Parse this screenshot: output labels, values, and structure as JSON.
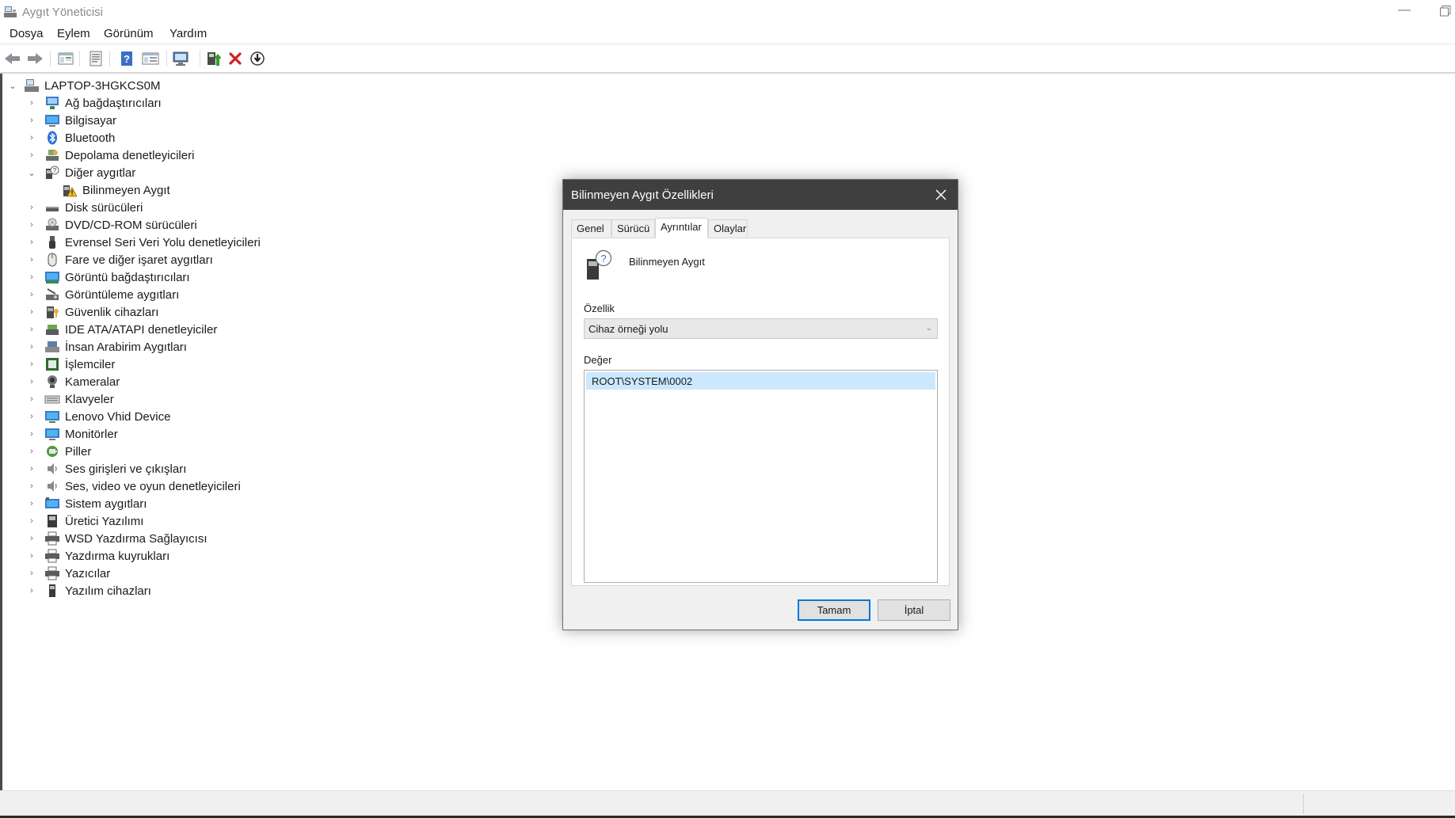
{
  "window": {
    "title": "Aygıt Yöneticisi"
  },
  "menu": [
    "Dosya",
    "Eylem",
    "Görünüm",
    "Yardım"
  ],
  "toolbar": [
    "back-icon",
    "forward-icon",
    "show-hide-tree-icon",
    "properties-icon",
    "help-icon",
    "view-resources-icon",
    "scan-hardware-icon",
    "update-driver-icon",
    "uninstall-icon",
    "disable-icon"
  ],
  "tree": {
    "root": "LAPTOP-3HGKCS0M",
    "items": [
      {
        "label": "Ağ bağdaştırıcıları",
        "icon": "network-adapter-icon",
        "expanded": false
      },
      {
        "label": "Bilgisayar",
        "icon": "computer-icon",
        "expanded": false
      },
      {
        "label": "Bluetooth",
        "icon": "bluetooth-icon",
        "expanded": false
      },
      {
        "label": "Depolama denetleyicileri",
        "icon": "storage-controller-icon",
        "expanded": false
      },
      {
        "label": "Diğer aygıtlar",
        "icon": "other-devices-icon",
        "expanded": true
      },
      {
        "label": "Bilinmeyen Aygıt",
        "icon": "unknown-device-warning-icon",
        "child": true
      },
      {
        "label": "Disk sürücüleri",
        "icon": "disk-drive-icon",
        "expanded": false
      },
      {
        "label": "DVD/CD-ROM sürücüleri",
        "icon": "dvd-drive-icon",
        "expanded": false
      },
      {
        "label": "Evrensel Seri Veri Yolu denetleyicileri",
        "icon": "usb-icon",
        "expanded": false
      },
      {
        "label": "Fare ve diğer işaret aygıtları",
        "icon": "mouse-icon",
        "expanded": false
      },
      {
        "label": "Görüntü bağdaştırıcıları",
        "icon": "display-adapter-icon",
        "expanded": false
      },
      {
        "label": "Görüntüleme aygıtları",
        "icon": "imaging-device-icon",
        "expanded": false
      },
      {
        "label": "Güvenlik cihazları",
        "icon": "security-device-icon",
        "expanded": false
      },
      {
        "label": "IDE ATA/ATAPI denetleyiciler",
        "icon": "ide-controller-icon",
        "expanded": false
      },
      {
        "label": "İnsan Arabirim Aygıtları",
        "icon": "hid-icon",
        "expanded": false
      },
      {
        "label": "İşlemciler",
        "icon": "processor-icon",
        "expanded": false
      },
      {
        "label": "Kameralar",
        "icon": "camera-icon",
        "expanded": false
      },
      {
        "label": "Klavyeler",
        "icon": "keyboard-icon",
        "expanded": false
      },
      {
        "label": "Lenovo Vhid Device",
        "icon": "lenovo-device-icon",
        "expanded": false
      },
      {
        "label": "Monitörler",
        "icon": "monitor-icon",
        "expanded": false
      },
      {
        "label": "Piller",
        "icon": "battery-icon",
        "expanded": false
      },
      {
        "label": "Ses girişleri ve çıkışları",
        "icon": "audio-io-icon",
        "expanded": false
      },
      {
        "label": "Ses, video ve oyun denetleyicileri",
        "icon": "sound-video-icon",
        "expanded": false
      },
      {
        "label": "Sistem aygıtları",
        "icon": "system-devices-icon",
        "expanded": false
      },
      {
        "label": "Üretici Yazılımı",
        "icon": "firmware-icon",
        "expanded": false
      },
      {
        "label": "WSD Yazdırma Sağlayıcısı",
        "icon": "wsd-print-icon",
        "expanded": false
      },
      {
        "label": "Yazdırma kuyrukları",
        "icon": "print-queue-icon",
        "expanded": false
      },
      {
        "label": "Yazıcılar",
        "icon": "printer-icon",
        "expanded": false
      },
      {
        "label": "Yazılım cihazları",
        "icon": "software-device-icon",
        "expanded": false
      }
    ]
  },
  "dialog": {
    "title": "Bilinmeyen Aygıt Özellikleri",
    "tabs": [
      "Genel",
      "Sürücü",
      "Ayrıntılar",
      "Olaylar"
    ],
    "active_tab": "Ayrıntılar",
    "device_name": "Bilinmeyen Aygıt",
    "property_label": "Özellik",
    "property_value": "Cihaz örneği yolu",
    "value_label": "Değer",
    "value_item": "ROOT\\SYSTEM\\0002",
    "ok_label": "Tamam",
    "cancel_label": "İptal"
  },
  "colors": {
    "accent": "#0078d7",
    "selection": "#cce8ff",
    "dialog_title_bg": "#3f3f3f"
  }
}
